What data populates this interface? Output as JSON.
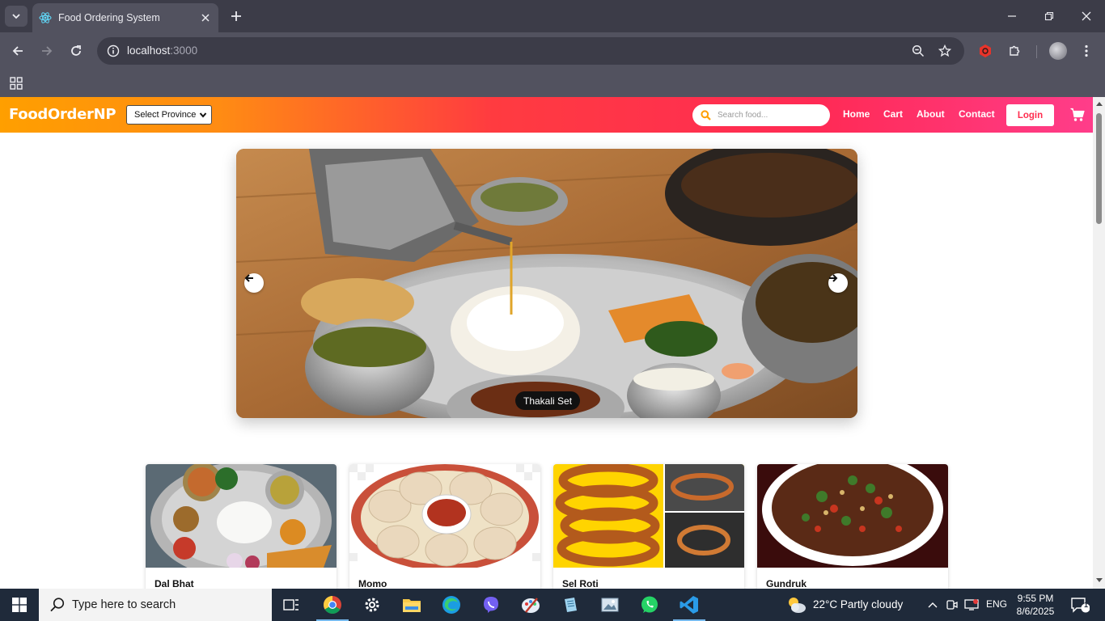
{
  "browser": {
    "tab_title": "Food Ordering System",
    "url_host": "localhost",
    "url_port": ":3000"
  },
  "site": {
    "logo": "FoodOrderNP",
    "province_select": "Select Province",
    "search_placeholder": "Search food...",
    "nav": [
      "Home",
      "Cart",
      "About",
      "Contact"
    ],
    "login_label": "Login",
    "carousel_caption": "Thakali Set"
  },
  "foods": [
    {
      "name": "Dal Bhat"
    },
    {
      "name": "Momo"
    },
    {
      "name": "Sel Roti"
    },
    {
      "name": "Gundruk"
    }
  ],
  "taskbar": {
    "search_placeholder": "Type here to search",
    "weather": "22°C  Partly cloudy",
    "language": "ENG",
    "time": "9:55 PM",
    "date": "8/6/2025",
    "notification_count": "1"
  },
  "colors": {
    "nav_gradient_start": "#ff9f00",
    "nav_gradient_end": "#ff3d8a",
    "login_text": "#ff2d4f"
  },
  "icons": [
    "menu-chevron-icon",
    "react-favicon-icon",
    "close-icon",
    "plus-icon",
    "minimize-icon",
    "restore-icon",
    "close-window-icon",
    "back-arrow-icon",
    "forward-arrow-icon",
    "reload-icon",
    "info-icon",
    "zoom-icon",
    "star-icon",
    "extension-shield-icon",
    "puzzle-icon",
    "kebab-menu-icon",
    "apps-grid-icon",
    "search-icon",
    "cart-icon",
    "arrow-left-icon",
    "arrow-right-icon",
    "windows-icon",
    "task-view-icon",
    "chrome-icon",
    "settings-icon",
    "file-explorer-icon",
    "edge-icon",
    "viber-icon",
    "paint-icon",
    "notepad-icon",
    "photos-icon",
    "whatsapp-icon",
    "vscode-icon",
    "weather-icon",
    "chevron-up-icon",
    "meet-icon",
    "display-icon",
    "notification-icon"
  ]
}
